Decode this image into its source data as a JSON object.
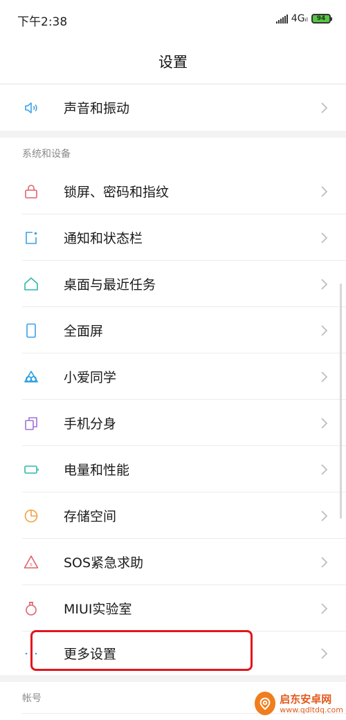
{
  "status_bar": {
    "time": "下午2:38",
    "network": "4G",
    "network_sub": "ıl",
    "battery": "94"
  },
  "header": {
    "title": "设置"
  },
  "top_items": [
    {
      "label": "声音和振动",
      "icon": "speaker-icon",
      "color": "#3aa0e8"
    }
  ],
  "section_system": {
    "title": "系统和设备",
    "items": [
      {
        "label": "锁屏、密码和指纹",
        "icon": "lock-icon",
        "color": "#e0606a"
      },
      {
        "label": "通知和状态栏",
        "icon": "notification-icon",
        "color": "#3aa0e8"
      },
      {
        "label": "桌面与最近任务",
        "icon": "home-icon",
        "color": "#2eb8a8"
      },
      {
        "label": "全面屏",
        "icon": "phone-screen-icon",
        "color": "#3aa0e8"
      },
      {
        "label": "小爱同学",
        "icon": "xiaoai-icon",
        "color": "#2a9fe0"
      },
      {
        "label": "手机分身",
        "icon": "dual-phone-icon",
        "color": "#a070d8"
      },
      {
        "label": "电量和性能",
        "icon": "battery-icon",
        "color": "#2eb8a8"
      },
      {
        "label": "存储空间",
        "icon": "pie-chart-icon",
        "color": "#f0a040"
      },
      {
        "label": "SOS紧急求助",
        "icon": "sos-icon",
        "color": "#e0606a"
      },
      {
        "label": "MIUI实验室",
        "icon": "flask-icon",
        "color": "#e0606a"
      },
      {
        "label": "更多设置",
        "icon": "more-dots-icon",
        "color": "#3aa0e8"
      }
    ]
  },
  "section_account": {
    "title": "帐号"
  },
  "watermark": {
    "name": "启东安卓网",
    "url": "www.qdltdq.com"
  }
}
